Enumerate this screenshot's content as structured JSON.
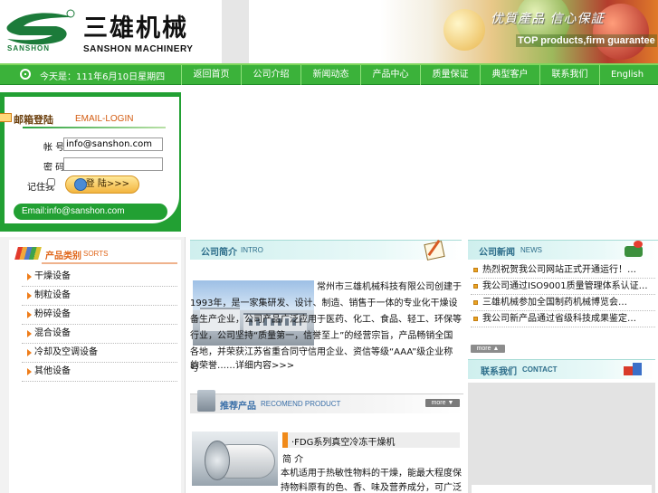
{
  "header": {
    "logo_en_small": "SANSHON",
    "company_cn": "三雄机械",
    "company_en": "SANSHON MACHINERY",
    "slogan_cn": "优質產品  信心保証",
    "slogan_en": "TOP products,firm guarantee"
  },
  "nav": {
    "date": "今天是：111年6月10日星期四",
    "items": [
      "返回首页",
      "公司介绍",
      "新闻动态",
      "产品中心",
      "质量保证",
      "典型客户",
      "联系我们",
      "English"
    ]
  },
  "login": {
    "title_cn": "邮箱登陆",
    "title_en": "EMAIL-LOGIN",
    "user_label": "帐 号:",
    "user_value": "info@sanshon.com",
    "pass_label": "密 码:",
    "pass_value": "",
    "remember_label": "记住我",
    "login_button": "登 陆>>>",
    "email": "Email:info@sanshon.com"
  },
  "sorts": {
    "title_cn": "产品类别",
    "title_en": "SORTS",
    "items": [
      "干燥设备",
      "制粒设备",
      "粉碎设备",
      "混合设备",
      "冷却及空调设备",
      "其他设备"
    ]
  },
  "intro": {
    "title_cn": "公司简介",
    "title_en": "INTRO",
    "text": "常州市三雄机械科技有限公司创建于1993年，是一家集研发、设计、制造、销售于一体的专业化干燥设备生产企业，公司产品广泛应用于医药、化工、食品、轻工、环保等行业，公司坚持“质量第一，信誉至上”的经营宗旨，产品畅销全国各地，并荣获江苏省重合同守信用企业、资信等级“AAA”级企业称号",
    "more": "的荣誉……详细内容>>>"
  },
  "recommend": {
    "title_cn": "推荐产品",
    "title_en": "RECOMEND PRODUCT",
    "more": "more ▼",
    "product_title": "·FDG系列真空冷冻干燥机",
    "product_sub": "简 介",
    "product_desc": "本机适用于热敏性物料的干燥，能最大程度保持物料原有的色、香、味及营养成分，可广泛用于医药、食品、化工等行业……"
  },
  "news": {
    "title_cn": "公司新闻",
    "title_en": "NEWS",
    "items": [
      "热烈祝贺我公司网站正式开通运行！…",
      "我公司通过ISO9001质量管理体系认证…",
      "三雄机械参加全国制药机械博览会…",
      "我公司新产品通过省级科技成果鉴定…"
    ],
    "more": "more ▲"
  },
  "contact": {
    "title_cn": "联系我们",
    "title_en": "CONTACT"
  }
}
